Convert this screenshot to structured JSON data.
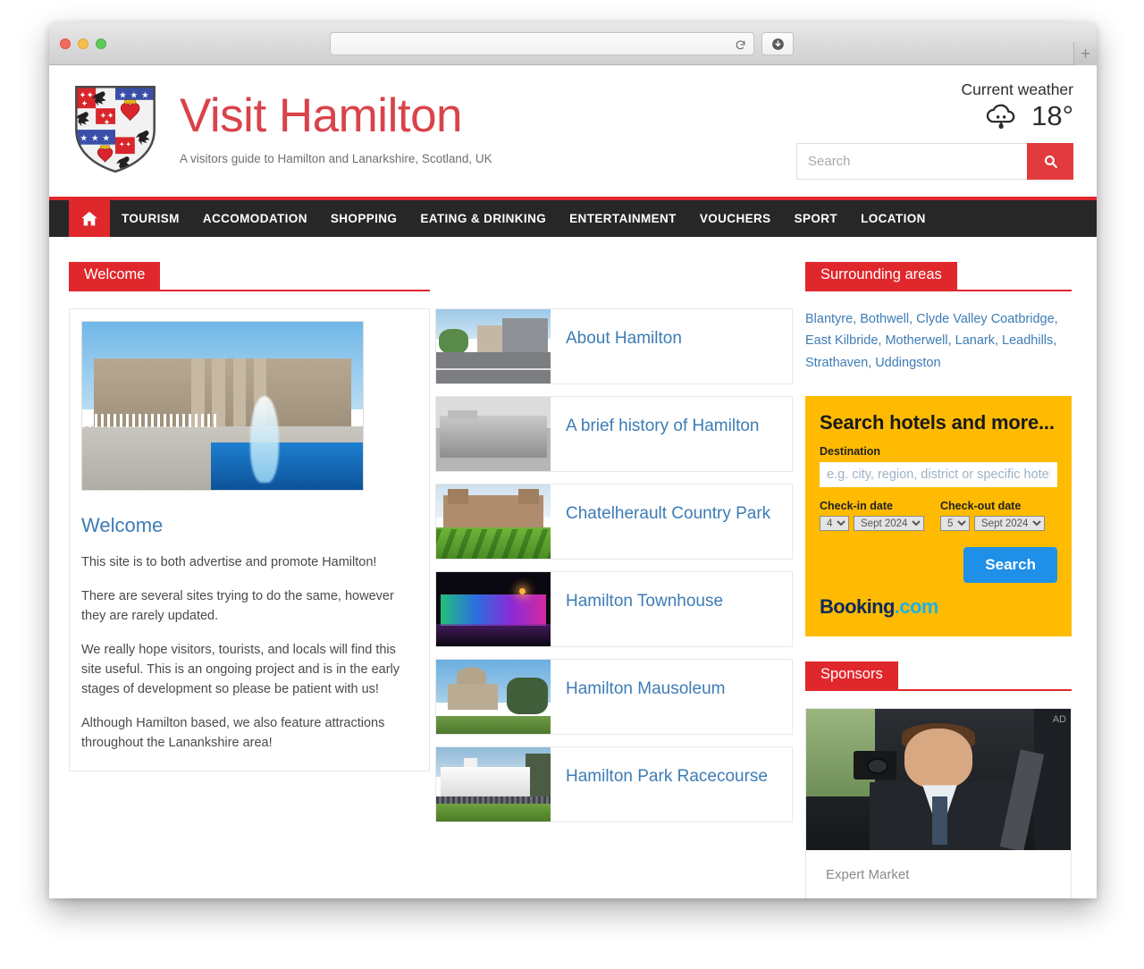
{
  "browser": {
    "address_value": "",
    "reload_icon": "reload-icon",
    "download_icon": "download-icon",
    "newtab_label": "+"
  },
  "header": {
    "logo_alt": "hamilton-coat-of-arms",
    "title": "Visit Hamilton",
    "tagline": "A visitors guide to Hamilton and Lanarkshire, Scotland, UK",
    "weather_label": "Current weather",
    "weather_icon": "rain-cloud-icon",
    "weather_temp": "18°",
    "search_placeholder": "Search",
    "search_value": "",
    "search_icon": "magnifier-icon"
  },
  "nav": {
    "home_icon": "home-icon",
    "items": [
      {
        "label": "TOURISM"
      },
      {
        "label": "ACCOMODATION"
      },
      {
        "label": "SHOPPING"
      },
      {
        "label": "EATING & DRINKING"
      },
      {
        "label": "ENTERTAINMENT"
      },
      {
        "label": "VOUCHERS"
      },
      {
        "label": "SPORT"
      },
      {
        "label": "LOCATION"
      }
    ]
  },
  "welcome": {
    "section_title": "Welcome",
    "photo_alt": "hamilton-town-fountain-photo",
    "heading": "Welcome",
    "paragraphs": [
      "This site is to both advertise and promote Hamilton!",
      "There are several sites trying to do the same, however they are rarely updated.",
      "We really hope visitors, tourists, and locals will find this site useful. This is an ongoing project and is in the early stages of development so please be patient with us!",
      "Although Hamilton based, we also feature attractions throughout the Lanankshire area!"
    ]
  },
  "articles": [
    {
      "title": "About Hamilton",
      "thumb": "hamilton-street-photo"
    },
    {
      "title": "A brief history of Hamilton",
      "thumb": "hamilton-palace-bw-photo"
    },
    {
      "title": "Chatelherault Country Park",
      "thumb": "chatelherault-photo"
    },
    {
      "title": "Hamilton Townhouse",
      "thumb": "townhouse-night-photo"
    },
    {
      "title": "Hamilton Mausoleum",
      "thumb": "mausoleum-photo"
    },
    {
      "title": "Hamilton Park Racecourse",
      "thumb": "racecourse-photo"
    }
  ],
  "areas": {
    "section_title": "Surrounding areas",
    "items": [
      "Blantyre",
      "Bothwell",
      "Clyde Valley",
      "Coatbridge",
      "East Kilbride",
      "Motherwell",
      "Lanark",
      "Leadhills",
      "Strathaven",
      "Uddingston"
    ]
  },
  "booking": {
    "title": "Search hotels and more...",
    "destination_label": "Destination",
    "destination_placeholder": "e.g. city, region, district or specific hotel",
    "destination_value": "",
    "checkin_label": "Check-in date",
    "checkin_day": "4",
    "checkin_month": "Sept 2024",
    "checkout_label": "Check-out date",
    "checkout_day": "5",
    "checkout_month": "Sept 2024",
    "search_label": "Search",
    "logo_primary": "Booking",
    "logo_suffix": ".com"
  },
  "sponsors": {
    "section_title": "Sponsors",
    "ad_mark": "AD",
    "image_alt": "man-with-camera-in-car-photo",
    "name": "Expert Market"
  },
  "colors": {
    "accent_red": "#e0272c",
    "link_blue": "#3d7cb5",
    "nav_dark": "#272727",
    "booking_yellow": "#febb02",
    "booking_button": "#1e90e8"
  }
}
